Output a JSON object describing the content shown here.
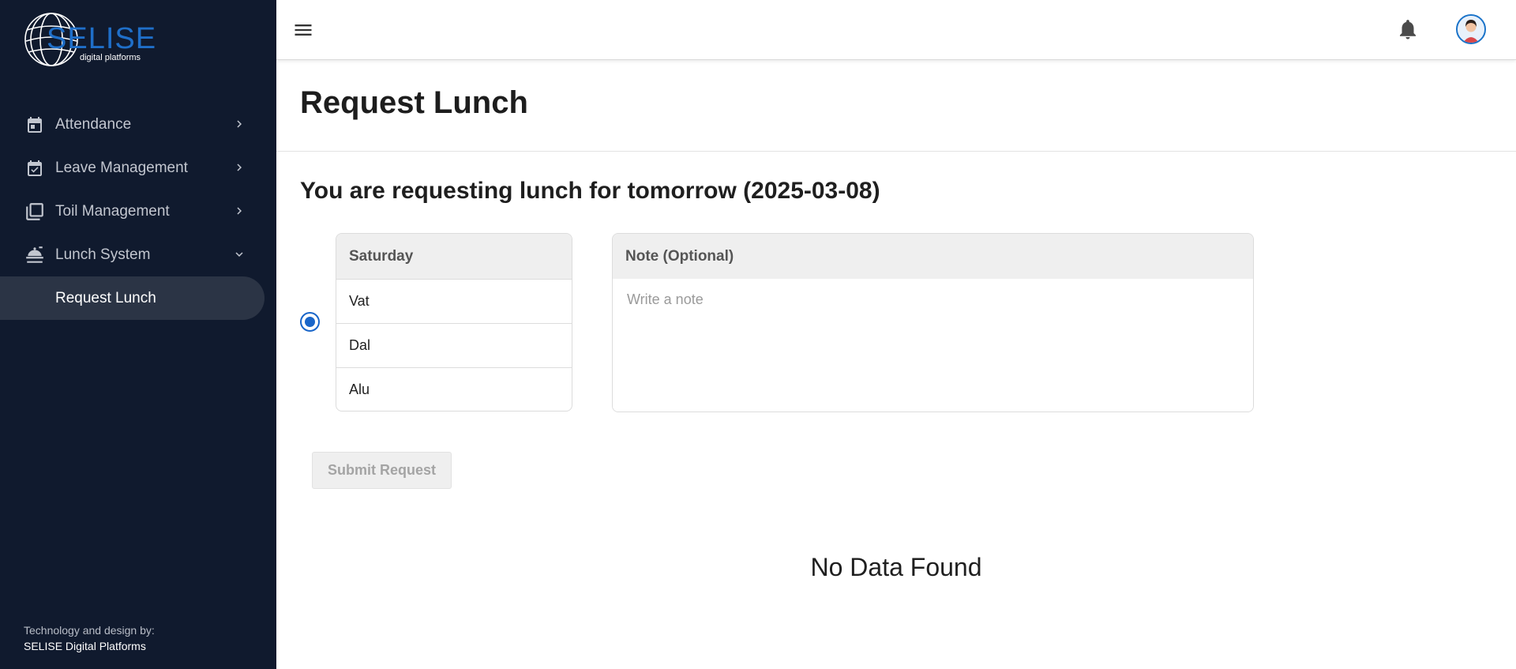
{
  "brand": {
    "logo_text": "SELISE",
    "logo_subtext": "digital platforms"
  },
  "sidebar": {
    "items": [
      {
        "label": "Attendance",
        "icon": "calendar-icon"
      },
      {
        "label": "Leave Management",
        "icon": "calendar-check-icon"
      },
      {
        "label": "Toil Management",
        "icon": "library-icon"
      },
      {
        "label": "Lunch System",
        "icon": "food-cover-icon",
        "expanded": true
      }
    ],
    "sub_items": [
      {
        "label": "Request Lunch",
        "active": true
      }
    ]
  },
  "footer": {
    "line1": "Technology and design by:",
    "line2": "SELISE Digital Platforms"
  },
  "topbar": {
    "menu_icon": "hamburger-icon",
    "notification_icon": "bell-icon",
    "avatar": "user-avatar"
  },
  "page": {
    "title": "Request Lunch",
    "subtitle": "You are requesting lunch for tomorrow (2025-03-08)"
  },
  "menu": {
    "day": "Saturday",
    "items": [
      "Vat",
      "Dal",
      "Alu"
    ],
    "selected": true
  },
  "note": {
    "header": "Note (Optional)",
    "placeholder": "Write a note",
    "value": ""
  },
  "actions": {
    "submit_label": "Submit Request"
  },
  "results": {
    "empty_text": "No Data Found"
  },
  "colors": {
    "sidebar_bg": "#101a2e",
    "accent": "#1a66c9",
    "active_item_bg": "#2b3445"
  }
}
